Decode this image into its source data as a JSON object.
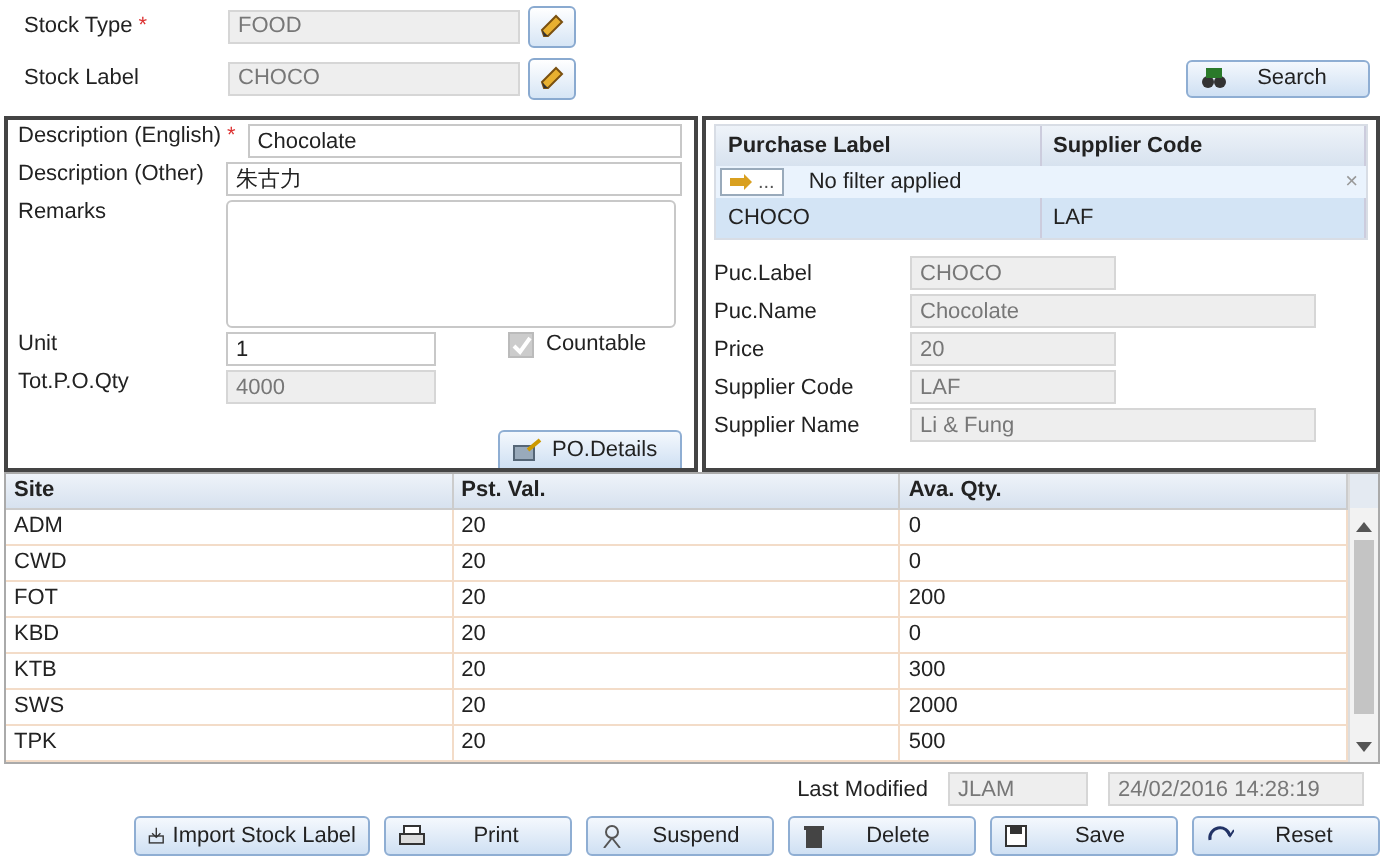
{
  "header": {
    "stock_type": {
      "label": "Stock Type",
      "required_mark": "*",
      "value": "FOOD"
    },
    "stock_label": {
      "label": "Stock Label",
      "value": "CHOCO"
    },
    "search_button": "Search"
  },
  "description_panel": {
    "fields": [
      {
        "label": "Description (English)",
        "required_mark": "*",
        "value": "Chocolate",
        "kind": "text"
      },
      {
        "label": "Description (Other)",
        "value": "朱古力",
        "kind": "text"
      },
      {
        "label": "Remarks",
        "kind": "area"
      }
    ],
    "unit": {
      "label": "Unit",
      "value": "1"
    },
    "countable": {
      "label": "Countable",
      "checked": true,
      "disabled": true
    },
    "tot_po_qty": {
      "label": "Tot.P.O.Qty",
      "value": "4000"
    },
    "po_details_button": "PO.Details"
  },
  "purchase_panel": {
    "columns": [
      "Purchase Label",
      "Supplier Code"
    ],
    "filter": {
      "button": "...",
      "text": "No filter applied",
      "clear": "×"
    },
    "rows": [
      {
        "cells": [
          "CHOCO",
          "LAF"
        ],
        "selected": true
      }
    ],
    "details": [
      {
        "label": "Puc.Label",
        "value": "CHOCO",
        "wide": false
      },
      {
        "label": "Puc.Name",
        "value": "Chocolate",
        "wide": true
      },
      {
        "label": "Price",
        "value": "20",
        "wide": false
      },
      {
        "label": "Supplier Code",
        "value": "LAF",
        "wide": false
      },
      {
        "label": "Supplier Name",
        "value": "Li & Fung",
        "wide": true
      }
    ]
  },
  "site_table": {
    "columns": [
      "Site",
      "Pst. Val.",
      "Ava. Qty."
    ],
    "rows": [
      [
        "ADM",
        "20",
        "0"
      ],
      [
        "CWD",
        "20",
        "0"
      ],
      [
        "FOT",
        "20",
        "200"
      ],
      [
        "KBD",
        "20",
        "0"
      ],
      [
        "KTB",
        "20",
        "300"
      ],
      [
        "SWS",
        "20",
        "2000"
      ],
      [
        "TPK",
        "20",
        "500"
      ]
    ]
  },
  "last_modified": {
    "label": "Last Modified",
    "user": "JLAM",
    "time": "24/02/2016 14:28:19"
  },
  "buttons": [
    {
      "label": "Import Stock Label",
      "kind": "import"
    },
    {
      "label": "Print",
      "kind": "print"
    },
    {
      "label": "Suspend",
      "kind": "suspend"
    },
    {
      "label": "Delete",
      "kind": "delete"
    },
    {
      "label": "Save",
      "kind": "save"
    },
    {
      "label": "Reset",
      "kind": "reset"
    }
  ]
}
